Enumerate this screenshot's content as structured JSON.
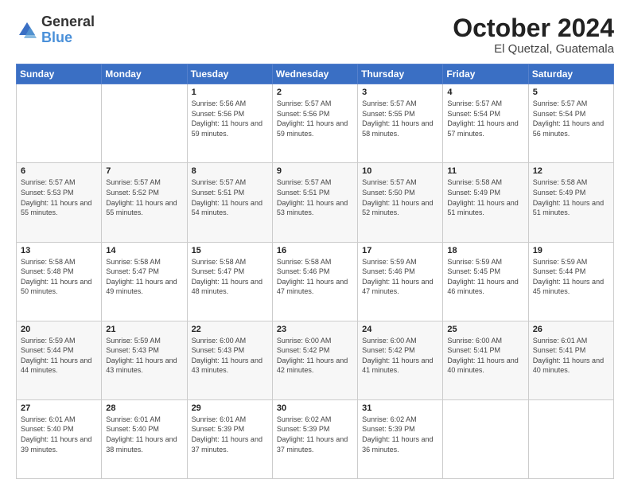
{
  "logo": {
    "general": "General",
    "blue": "Blue"
  },
  "header": {
    "month": "October 2024",
    "location": "El Quetzal, Guatemala"
  },
  "days_of_week": [
    "Sunday",
    "Monday",
    "Tuesday",
    "Wednesday",
    "Thursday",
    "Friday",
    "Saturday"
  ],
  "weeks": [
    [
      {
        "day": "",
        "sunrise": "",
        "sunset": "",
        "daylight": ""
      },
      {
        "day": "",
        "sunrise": "",
        "sunset": "",
        "daylight": ""
      },
      {
        "day": "1",
        "sunrise": "Sunrise: 5:56 AM",
        "sunset": "Sunset: 5:56 PM",
        "daylight": "Daylight: 11 hours and 59 minutes."
      },
      {
        "day": "2",
        "sunrise": "Sunrise: 5:57 AM",
        "sunset": "Sunset: 5:56 PM",
        "daylight": "Daylight: 11 hours and 59 minutes."
      },
      {
        "day": "3",
        "sunrise": "Sunrise: 5:57 AM",
        "sunset": "Sunset: 5:55 PM",
        "daylight": "Daylight: 11 hours and 58 minutes."
      },
      {
        "day": "4",
        "sunrise": "Sunrise: 5:57 AM",
        "sunset": "Sunset: 5:54 PM",
        "daylight": "Daylight: 11 hours and 57 minutes."
      },
      {
        "day": "5",
        "sunrise": "Sunrise: 5:57 AM",
        "sunset": "Sunset: 5:54 PM",
        "daylight": "Daylight: 11 hours and 56 minutes."
      }
    ],
    [
      {
        "day": "6",
        "sunrise": "Sunrise: 5:57 AM",
        "sunset": "Sunset: 5:53 PM",
        "daylight": "Daylight: 11 hours and 55 minutes."
      },
      {
        "day": "7",
        "sunrise": "Sunrise: 5:57 AM",
        "sunset": "Sunset: 5:52 PM",
        "daylight": "Daylight: 11 hours and 55 minutes."
      },
      {
        "day": "8",
        "sunrise": "Sunrise: 5:57 AM",
        "sunset": "Sunset: 5:51 PM",
        "daylight": "Daylight: 11 hours and 54 minutes."
      },
      {
        "day": "9",
        "sunrise": "Sunrise: 5:57 AM",
        "sunset": "Sunset: 5:51 PM",
        "daylight": "Daylight: 11 hours and 53 minutes."
      },
      {
        "day": "10",
        "sunrise": "Sunrise: 5:57 AM",
        "sunset": "Sunset: 5:50 PM",
        "daylight": "Daylight: 11 hours and 52 minutes."
      },
      {
        "day": "11",
        "sunrise": "Sunrise: 5:58 AM",
        "sunset": "Sunset: 5:49 PM",
        "daylight": "Daylight: 11 hours and 51 minutes."
      },
      {
        "day": "12",
        "sunrise": "Sunrise: 5:58 AM",
        "sunset": "Sunset: 5:49 PM",
        "daylight": "Daylight: 11 hours and 51 minutes."
      }
    ],
    [
      {
        "day": "13",
        "sunrise": "Sunrise: 5:58 AM",
        "sunset": "Sunset: 5:48 PM",
        "daylight": "Daylight: 11 hours and 50 minutes."
      },
      {
        "day": "14",
        "sunrise": "Sunrise: 5:58 AM",
        "sunset": "Sunset: 5:47 PM",
        "daylight": "Daylight: 11 hours and 49 minutes."
      },
      {
        "day": "15",
        "sunrise": "Sunrise: 5:58 AM",
        "sunset": "Sunset: 5:47 PM",
        "daylight": "Daylight: 11 hours and 48 minutes."
      },
      {
        "day": "16",
        "sunrise": "Sunrise: 5:58 AM",
        "sunset": "Sunset: 5:46 PM",
        "daylight": "Daylight: 11 hours and 47 minutes."
      },
      {
        "day": "17",
        "sunrise": "Sunrise: 5:59 AM",
        "sunset": "Sunset: 5:46 PM",
        "daylight": "Daylight: 11 hours and 47 minutes."
      },
      {
        "day": "18",
        "sunrise": "Sunrise: 5:59 AM",
        "sunset": "Sunset: 5:45 PM",
        "daylight": "Daylight: 11 hours and 46 minutes."
      },
      {
        "day": "19",
        "sunrise": "Sunrise: 5:59 AM",
        "sunset": "Sunset: 5:44 PM",
        "daylight": "Daylight: 11 hours and 45 minutes."
      }
    ],
    [
      {
        "day": "20",
        "sunrise": "Sunrise: 5:59 AM",
        "sunset": "Sunset: 5:44 PM",
        "daylight": "Daylight: 11 hours and 44 minutes."
      },
      {
        "day": "21",
        "sunrise": "Sunrise: 5:59 AM",
        "sunset": "Sunset: 5:43 PM",
        "daylight": "Daylight: 11 hours and 43 minutes."
      },
      {
        "day": "22",
        "sunrise": "Sunrise: 6:00 AM",
        "sunset": "Sunset: 5:43 PM",
        "daylight": "Daylight: 11 hours and 43 minutes."
      },
      {
        "day": "23",
        "sunrise": "Sunrise: 6:00 AM",
        "sunset": "Sunset: 5:42 PM",
        "daylight": "Daylight: 11 hours and 42 minutes."
      },
      {
        "day": "24",
        "sunrise": "Sunrise: 6:00 AM",
        "sunset": "Sunset: 5:42 PM",
        "daylight": "Daylight: 11 hours and 41 minutes."
      },
      {
        "day": "25",
        "sunrise": "Sunrise: 6:00 AM",
        "sunset": "Sunset: 5:41 PM",
        "daylight": "Daylight: 11 hours and 40 minutes."
      },
      {
        "day": "26",
        "sunrise": "Sunrise: 6:01 AM",
        "sunset": "Sunset: 5:41 PM",
        "daylight": "Daylight: 11 hours and 40 minutes."
      }
    ],
    [
      {
        "day": "27",
        "sunrise": "Sunrise: 6:01 AM",
        "sunset": "Sunset: 5:40 PM",
        "daylight": "Daylight: 11 hours and 39 minutes."
      },
      {
        "day": "28",
        "sunrise": "Sunrise: 6:01 AM",
        "sunset": "Sunset: 5:40 PM",
        "daylight": "Daylight: 11 hours and 38 minutes."
      },
      {
        "day": "29",
        "sunrise": "Sunrise: 6:01 AM",
        "sunset": "Sunset: 5:39 PM",
        "daylight": "Daylight: 11 hours and 37 minutes."
      },
      {
        "day": "30",
        "sunrise": "Sunrise: 6:02 AM",
        "sunset": "Sunset: 5:39 PM",
        "daylight": "Daylight: 11 hours and 37 minutes."
      },
      {
        "day": "31",
        "sunrise": "Sunrise: 6:02 AM",
        "sunset": "Sunset: 5:39 PM",
        "daylight": "Daylight: 11 hours and 36 minutes."
      },
      {
        "day": "",
        "sunrise": "",
        "sunset": "",
        "daylight": ""
      },
      {
        "day": "",
        "sunrise": "",
        "sunset": "",
        "daylight": ""
      }
    ]
  ]
}
